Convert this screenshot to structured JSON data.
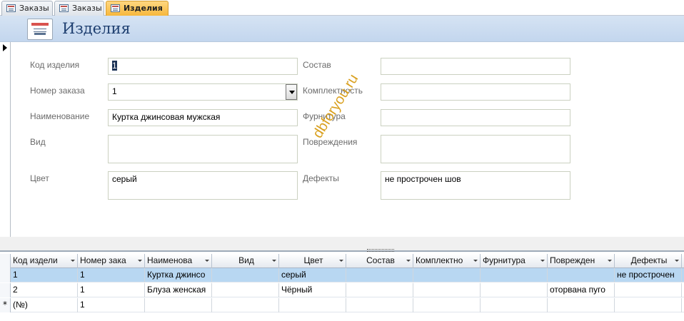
{
  "tabs": [
    {
      "label": "Заказы",
      "active": false
    },
    {
      "label": "Заказы",
      "active": false
    },
    {
      "label": "Изделия",
      "active": true
    }
  ],
  "form": {
    "title": "Изделия",
    "watermark": "dbforyou.ru",
    "left_fields": [
      {
        "label": "Код изделия",
        "value": "1"
      },
      {
        "label": "Номер заказа",
        "value": "1"
      },
      {
        "label": "Наименование",
        "value": "Куртка джинсовая мужская"
      },
      {
        "label": "Вид",
        "value": ""
      },
      {
        "label": "Цвет",
        "value": "серый"
      }
    ],
    "right_fields": [
      {
        "label": "Состав",
        "value": ""
      },
      {
        "label": "Комплектность",
        "value": ""
      },
      {
        "label": "Фурнитура",
        "value": ""
      },
      {
        "label": "Повреждения",
        "value": ""
      },
      {
        "label": "Дефекты",
        "value": "не прострочен шов"
      }
    ]
  },
  "datasheet": {
    "columns": [
      "Код издели",
      "Номер зака",
      "Наименова",
      "Вид",
      "Цвет",
      "Состав",
      "Комплектно",
      "Фурнитура",
      "Поврежден",
      "Дефекты"
    ],
    "rows": [
      {
        "selector": "",
        "cells": [
          "1",
          "1",
          "Куртка джинсо",
          "",
          "серый",
          "",
          "",
          "",
          "",
          "не прострочен"
        ]
      },
      {
        "selector": "",
        "cells": [
          "2",
          "1",
          "Блуза женская",
          "",
          "Чёрный",
          "",
          "",
          "",
          "оторвана пуго",
          ""
        ]
      },
      {
        "selector": "*",
        "cells": [
          "(№)",
          "1",
          "",
          "",
          "",
          "",
          "",
          "",
          "",
          ""
        ]
      }
    ]
  },
  "colors": {
    "active_tab": "#f6b73c",
    "header": "#c3d6ee",
    "selected_row": "#b8d7f2",
    "watermark": "#d79b13"
  }
}
